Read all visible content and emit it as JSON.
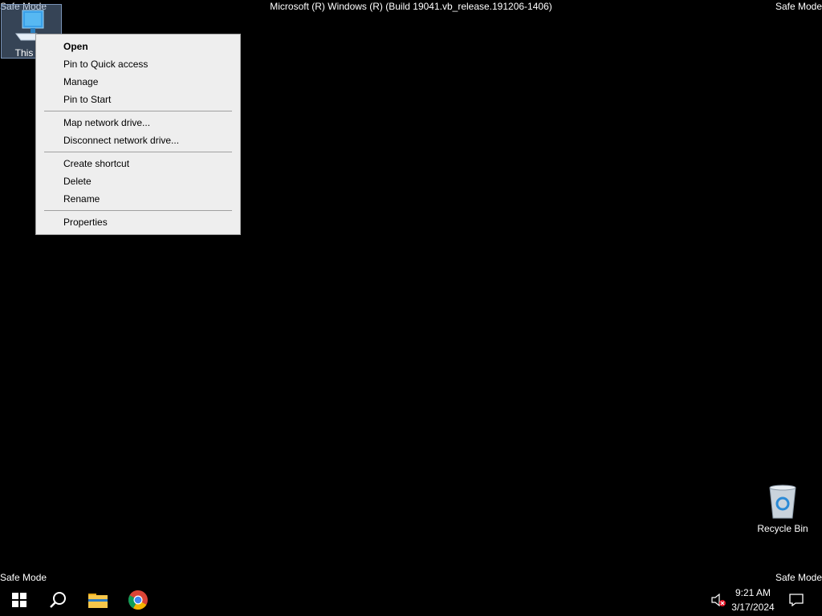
{
  "watermarks": {
    "top_left": "Safe Mode",
    "top_right": "Safe Mode",
    "bottom_left": "Safe Mode",
    "bottom_right": "Safe Mode",
    "title": "Microsoft (R) Windows (R) (Build 19041.vb_release.191206-1406)"
  },
  "desktop": {
    "this_pc_label": "This",
    "recycle_bin_label": "Recycle Bin"
  },
  "context_menu": {
    "items": [
      {
        "label": "Open",
        "bold": true
      },
      {
        "label": "Pin to Quick access"
      },
      {
        "label": "Manage"
      },
      {
        "label": "Pin to Start"
      },
      {
        "label": "Map network drive..."
      },
      {
        "label": "Disconnect network drive..."
      },
      {
        "label": "Create shortcut"
      },
      {
        "label": "Delete"
      },
      {
        "label": "Rename"
      },
      {
        "label": "Properties"
      }
    ]
  },
  "taskbar": {
    "icons": [
      "windows-start-icon",
      "search-icon",
      "file-explorer-icon",
      "chrome-icon"
    ],
    "tray": {
      "volume_icon": "volume-muted-icon",
      "time": "9:21 AM",
      "date": "3/17/2024",
      "notification_icon": "action-center-icon"
    }
  }
}
